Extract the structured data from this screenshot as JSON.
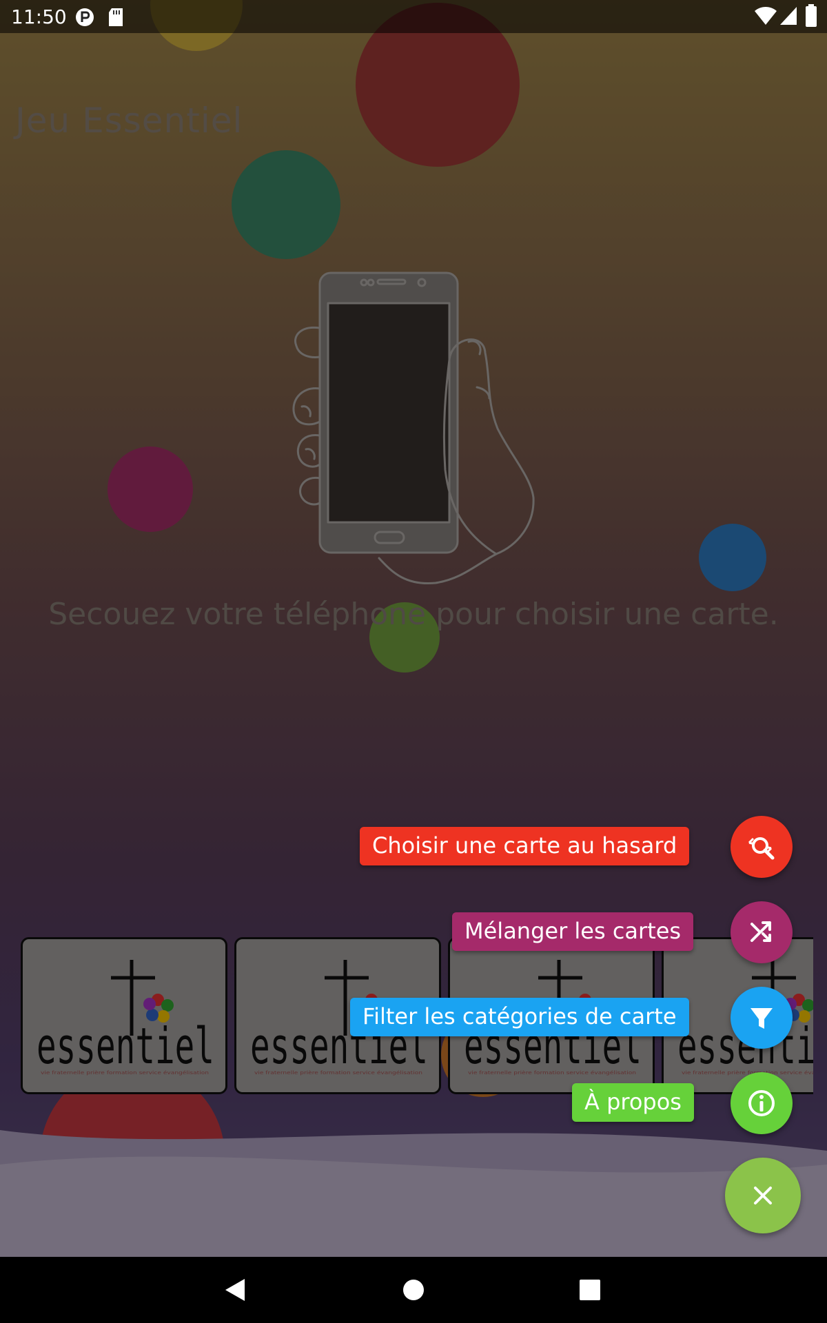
{
  "status_bar": {
    "time": "11:50"
  },
  "app": {
    "title": "Jeu Essentiel"
  },
  "main": {
    "hint": "Secouez votre téléphone pour choisir une carte."
  },
  "cards": [
    {
      "word": "essentiel",
      "tagline": "vie fraternelle prière formation service évangélisation"
    },
    {
      "word": "essentiel",
      "tagline": "vie fraternelle prière formation service évangélisation"
    },
    {
      "word": "essentiel",
      "tagline": "vie fraternelle prière formation service évangélisation"
    },
    {
      "word": "essentiel",
      "tagline": "vie fraternelle prière formation service évangélisation"
    }
  ],
  "fab_menu": {
    "random_label": "Choisir une carte au hasard",
    "shuffle_label": "Mélanger les cartes",
    "filter_label": "Filter les catégories de carte",
    "about_label": "À propos"
  },
  "colors": {
    "random": "#ee3322",
    "shuffle": "#a52a6a",
    "filter": "#1aa3f2",
    "about": "#66d13a",
    "close": "#8bc34a"
  }
}
